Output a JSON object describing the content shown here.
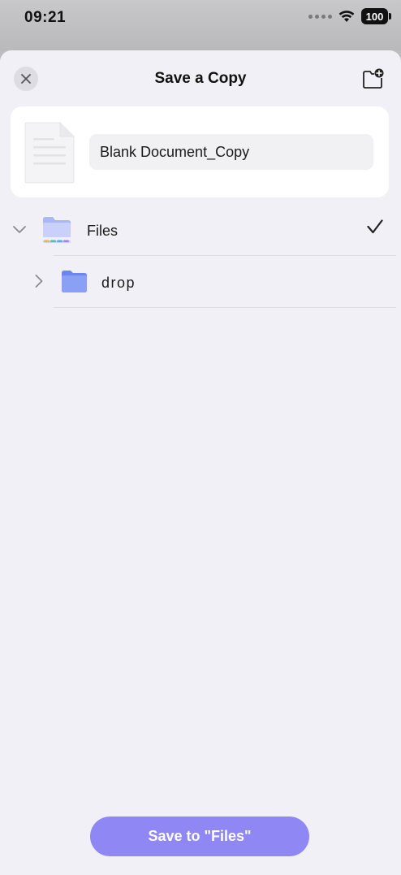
{
  "status_bar": {
    "time": "09:21",
    "battery": "100"
  },
  "header": {
    "title": "Save a Copy",
    "close_icon": "close-icon",
    "new_folder_icon": "new-folder-icon"
  },
  "document": {
    "name_value": "Blank Document_Copy"
  },
  "tree": {
    "items": [
      {
        "label": "Files",
        "expanded": true,
        "selected": true
      },
      {
        "label": "drop",
        "expanded": false,
        "selected": false
      }
    ]
  },
  "footer": {
    "save_label": "Save to \"Files\""
  },
  "colors": {
    "accent": "#8f87f4",
    "folder": "#7d96f3",
    "sheet_bg": "#f1f0f6"
  }
}
